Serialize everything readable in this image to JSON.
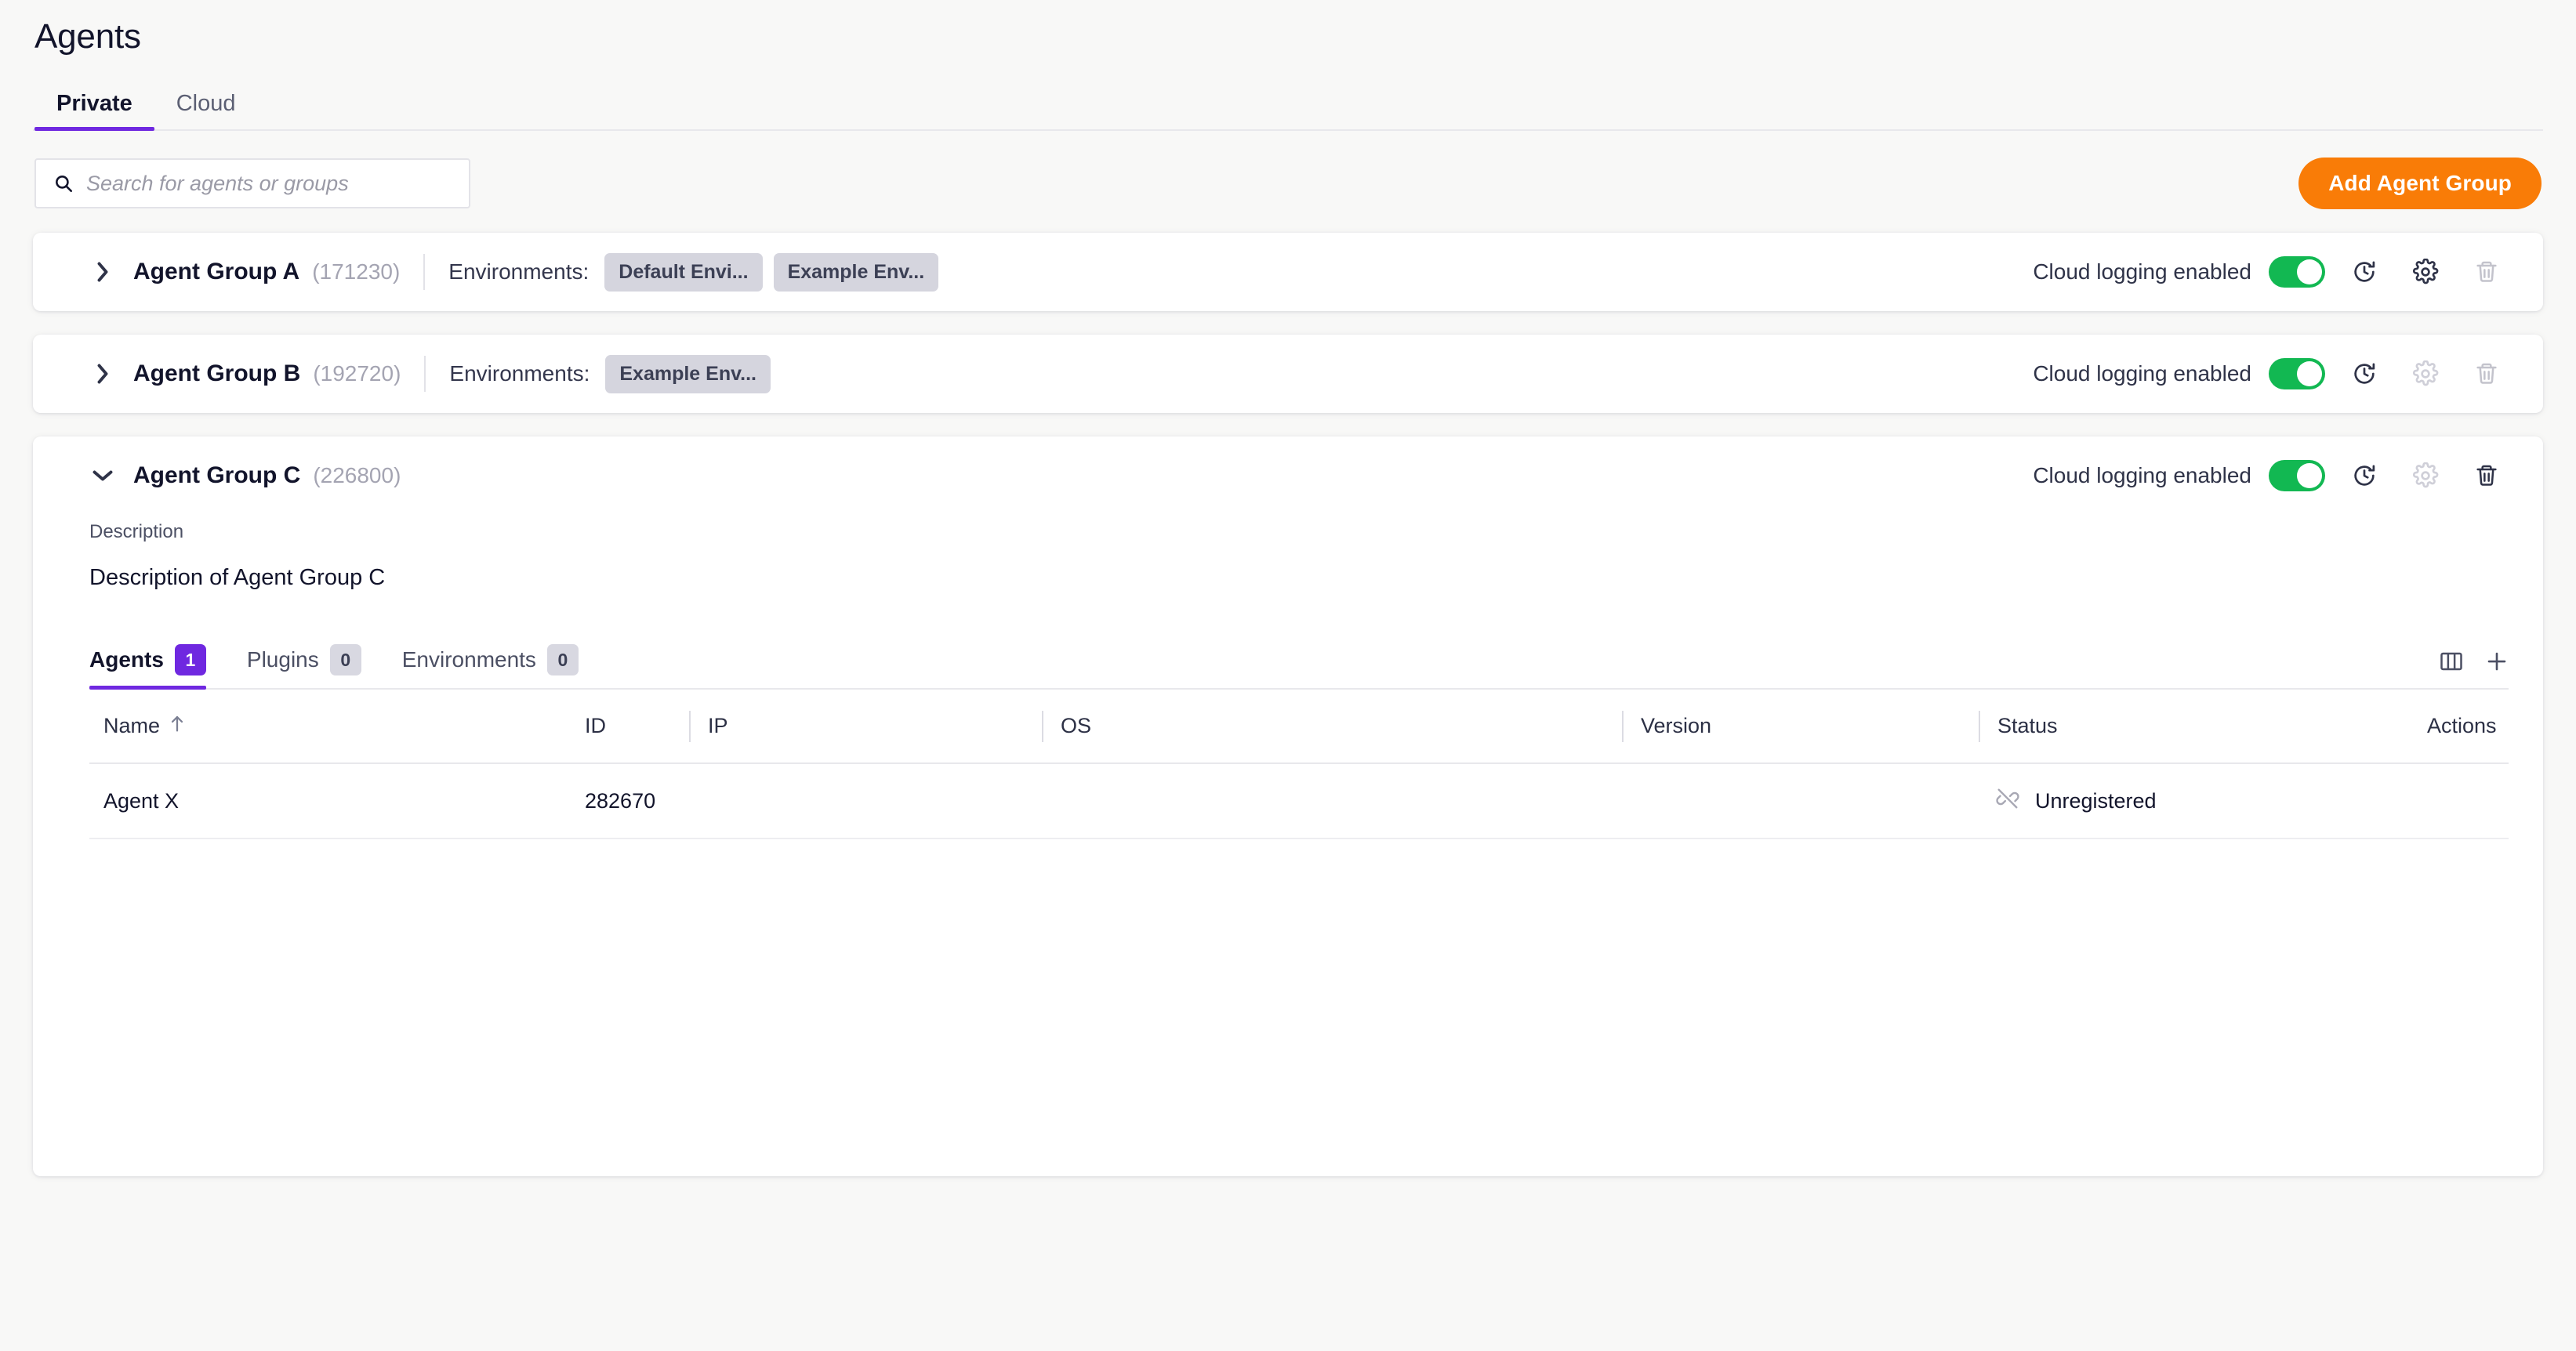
{
  "page": {
    "title": "Agents"
  },
  "top_tabs": [
    {
      "label": "Private",
      "active": true
    },
    {
      "label": "Cloud",
      "active": false
    }
  ],
  "search": {
    "placeholder": "Search for agents or groups",
    "value": "",
    "icon": "search-icon"
  },
  "add_button": {
    "label": "Add Agent Group",
    "color": "#f97c07"
  },
  "colors": {
    "accent_purple": "#6f28e0",
    "toggle_green": "#12b852",
    "orange": "#f97c07",
    "page_bg": "#f8f8f7",
    "chip_bg": "#d5d5de"
  },
  "groups": [
    {
      "name": "Agent Group A",
      "id": "(171230)",
      "expanded": false,
      "chevron": "chevron-right-icon",
      "environments_label": "Environments:",
      "environments": [
        "Default Envi...",
        "Example Env..."
      ],
      "logging_label": "Cloud logging enabled",
      "logging_on": true,
      "actions": [
        {
          "icon": "restart-history-icon",
          "enabled": true
        },
        {
          "icon": "gear-icon",
          "enabled": true
        },
        {
          "icon": "trash-icon",
          "enabled": false
        }
      ]
    },
    {
      "name": "Agent Group B",
      "id": "(192720)",
      "expanded": false,
      "chevron": "chevron-right-icon",
      "environments_label": "Environments:",
      "environments": [
        "Example Env..."
      ],
      "logging_label": "Cloud logging enabled",
      "logging_on": true,
      "actions": [
        {
          "icon": "restart-history-icon",
          "enabled": true
        },
        {
          "icon": "gear-icon",
          "enabled": false
        },
        {
          "icon": "trash-icon",
          "enabled": false
        }
      ]
    },
    {
      "name": "Agent Group C",
      "id": "(226800)",
      "expanded": true,
      "chevron": "chevron-down-icon",
      "environments_label": "",
      "environments": [],
      "logging_label": "Cloud logging enabled",
      "logging_on": true,
      "actions": [
        {
          "icon": "restart-history-icon",
          "enabled": true
        },
        {
          "icon": "gear-icon",
          "enabled": false
        },
        {
          "icon": "trash-icon",
          "enabled": true
        }
      ],
      "description_label": "Description",
      "description_value": "Description of Agent Group C",
      "inner_tabs": [
        {
          "label": "Agents",
          "count": "1",
          "active": true
        },
        {
          "label": "Plugins",
          "count": "0",
          "active": false
        },
        {
          "label": "Environments",
          "count": "0",
          "active": false
        }
      ],
      "table_tools": [
        {
          "icon": "columns-icon"
        },
        {
          "icon": "plus-icon"
        }
      ],
      "table": {
        "columns": [
          {
            "label": "Name",
            "sort": "ascending",
            "sort_icon": "arrow-up-icon",
            "divider": false
          },
          {
            "label": "ID",
            "divider": false
          },
          {
            "label": "IP",
            "divider": true
          },
          {
            "label": "OS",
            "divider": true
          },
          {
            "label": "Version",
            "divider": true
          },
          {
            "label": "Status",
            "divider": true
          },
          {
            "label": "Actions",
            "divider": false
          }
        ],
        "rows": [
          {
            "name": "Agent X",
            "id": "282670",
            "ip": "",
            "os": "",
            "version": "",
            "status": "Unregistered",
            "status_icon": "unlink-icon",
            "actions": ""
          }
        ]
      }
    }
  ]
}
